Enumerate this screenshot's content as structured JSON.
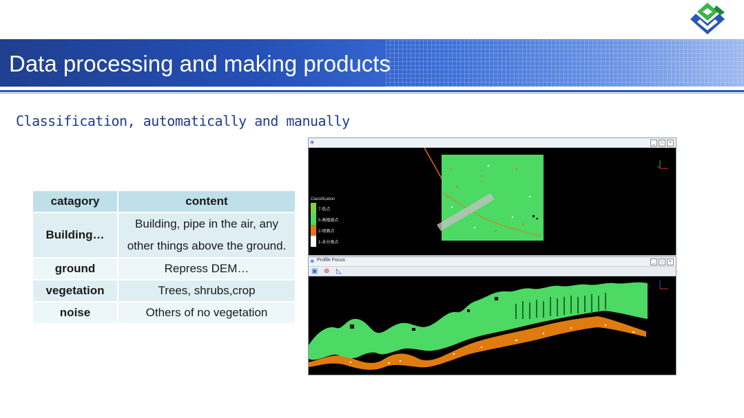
{
  "slide": {
    "title": "Data processing and making products",
    "subtitle": "Classification, automatically and manually"
  },
  "logo": {
    "icon": "company-logo-icon",
    "colors": [
      "#2a56b8",
      "#3cb54a",
      "#1c8a3a"
    ]
  },
  "table": {
    "headers": [
      "catagory",
      "content"
    ],
    "rows": [
      {
        "category": "Building…",
        "content_line1": "Building, pipe in the air, any",
        "content_line2": "other things above the ground."
      },
      {
        "category": "ground",
        "content": "Repress DEM…"
      },
      {
        "category": "vegetation",
        "content": "Trees, shrubs,crop"
      },
      {
        "category": "noise",
        "content": "Others of no vegetation"
      }
    ]
  },
  "plan_window": {
    "title": "",
    "legend_title": "Classification",
    "legend": [
      {
        "label": "7-低点",
        "color": "#7fd13a"
      },
      {
        "label": "5-高植被点",
        "color": "#4cd964"
      },
      {
        "label": "2-地面点",
        "color": "#e07b10"
      },
      {
        "label": "1-未分类点",
        "color": "#ffffff"
      }
    ],
    "buttons": [
      "_",
      "□",
      "×"
    ]
  },
  "profile_window": {
    "title": "Profile Focus",
    "buttons": [
      "_",
      "□",
      "×"
    ],
    "toolbar_icons": [
      "save-icon",
      "crosshair-icon",
      "ruler-icon"
    ]
  },
  "colors": {
    "vegetation": "#4cd964",
    "ground": "#e07b10",
    "unclassified": "#ffffff",
    "banner": "#2550b8",
    "subtitle": "#1f3a93"
  }
}
